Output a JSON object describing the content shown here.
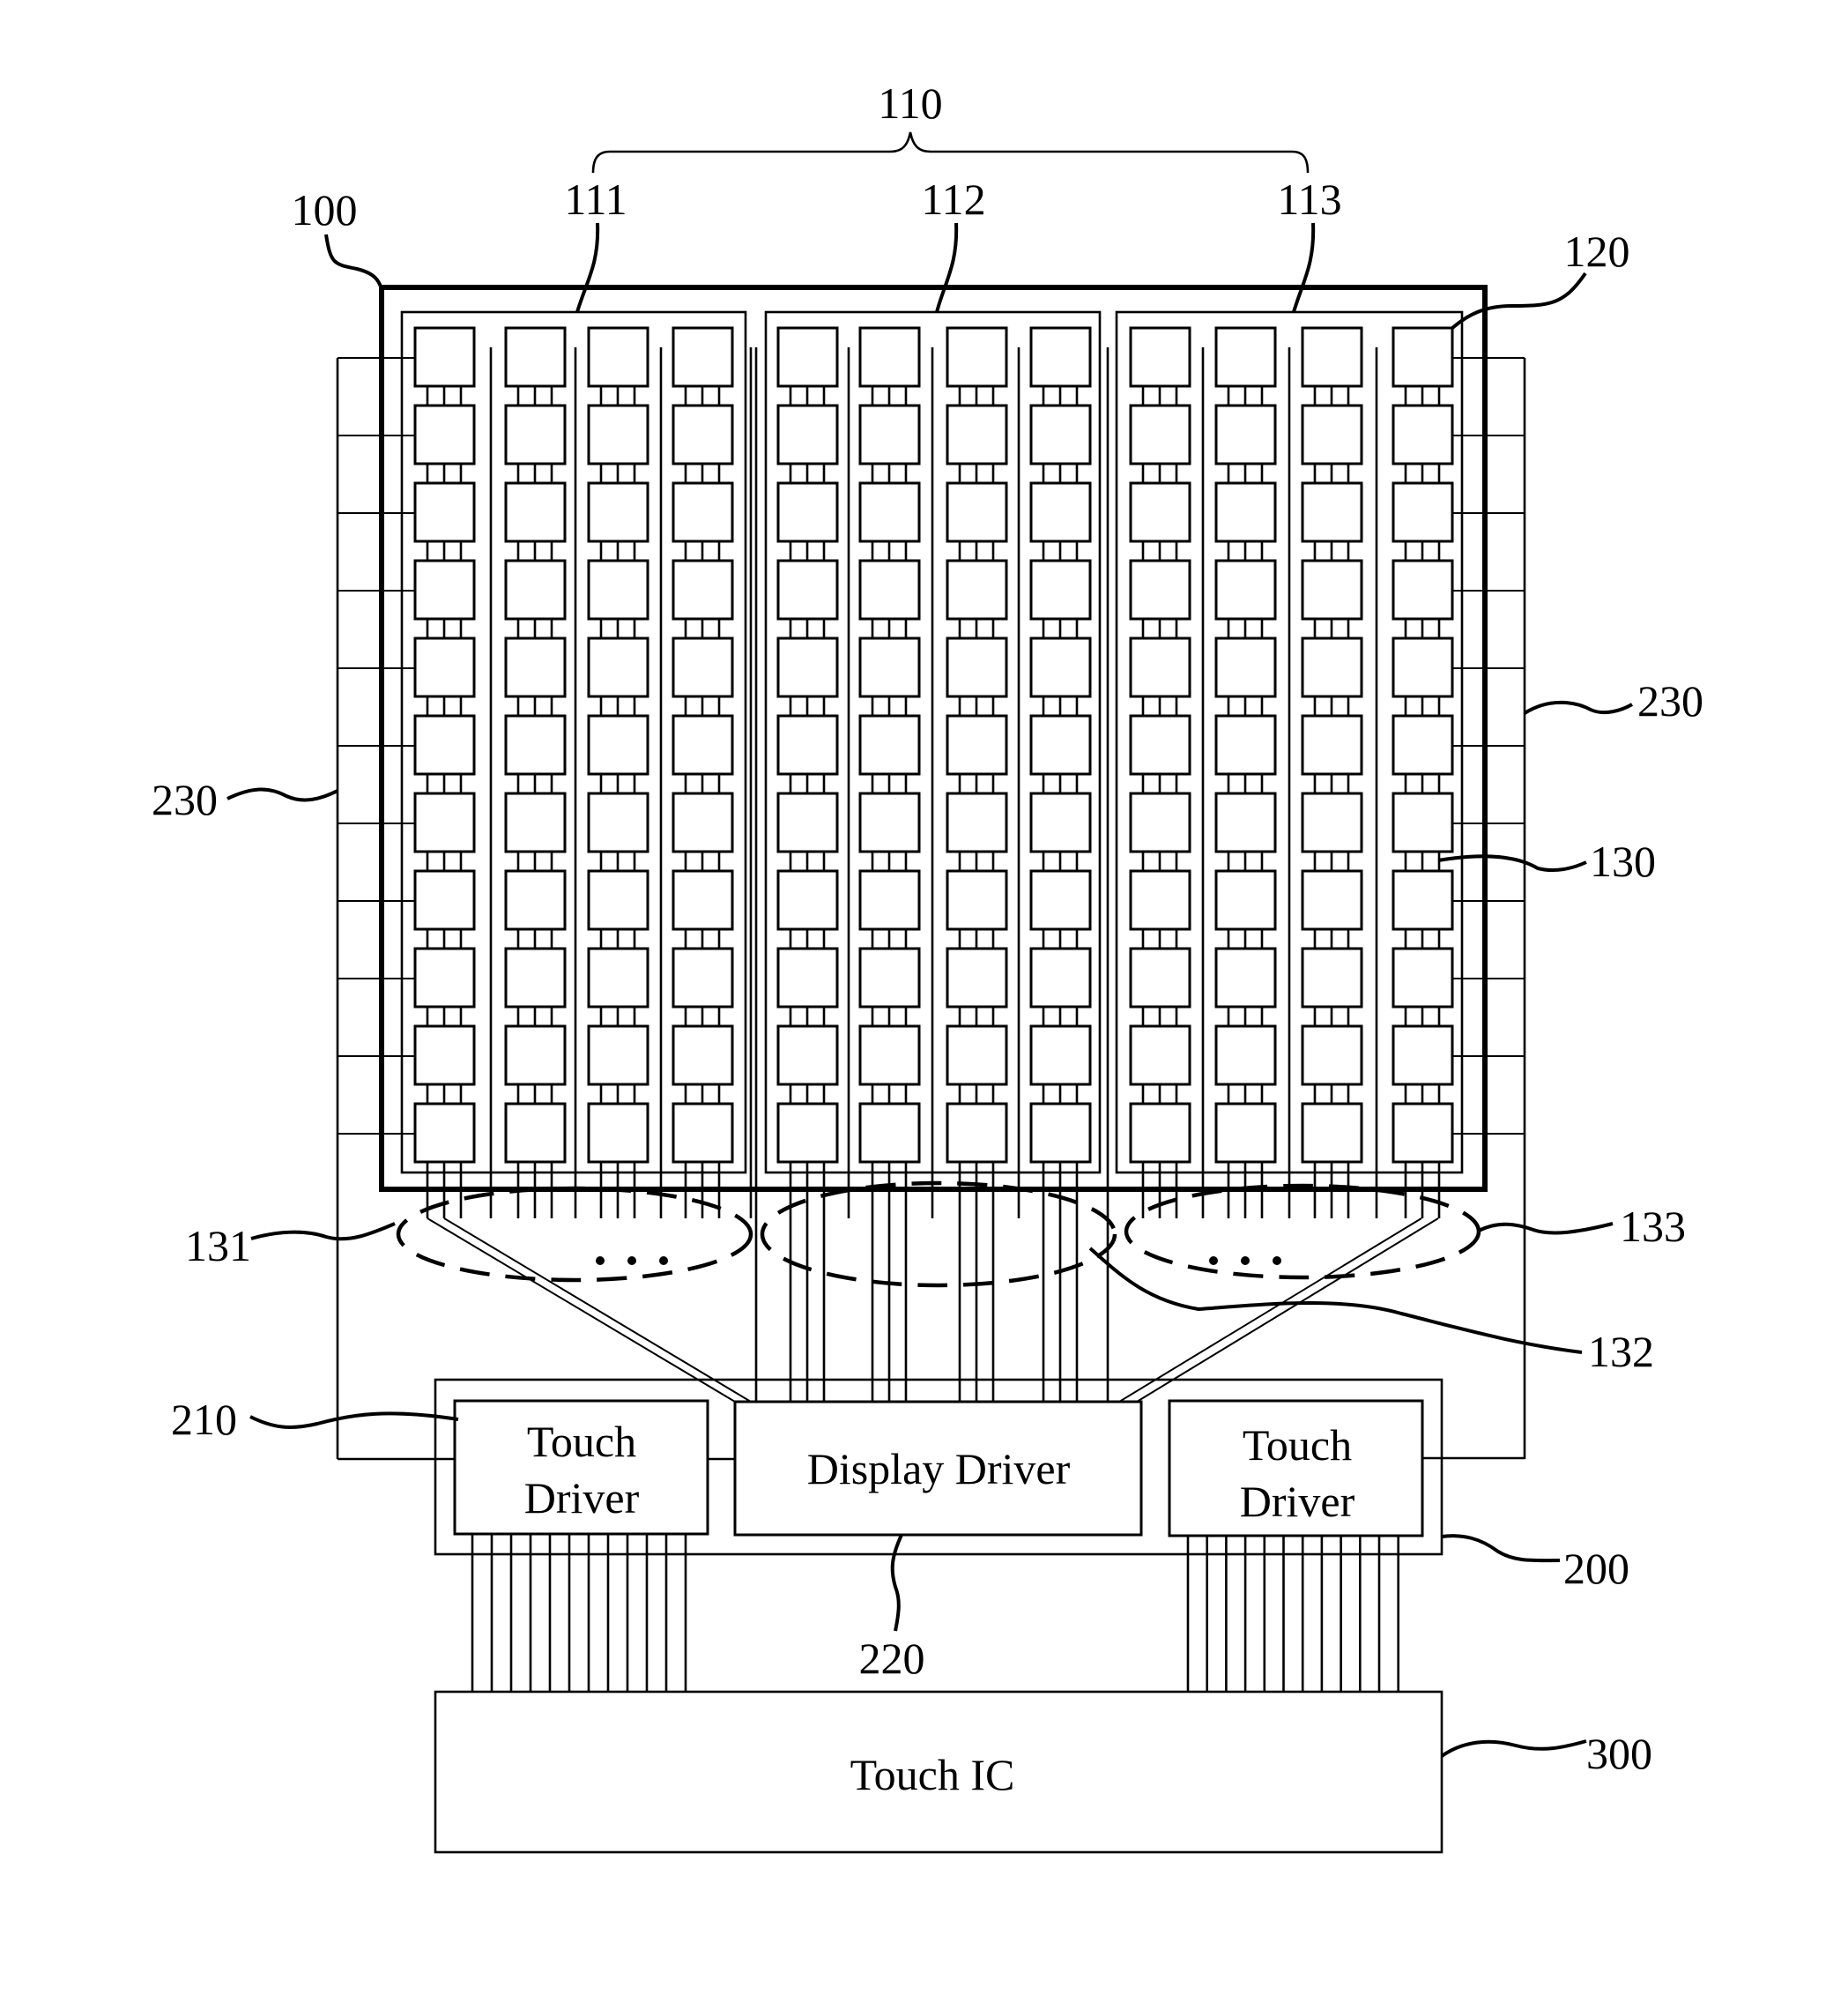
{
  "figure": {
    "type": "patent-block-diagram",
    "description": "Touch display panel with grouped touch electrode columns, display/touch drivers and Touch IC"
  },
  "reference_numerals": {
    "panel": "100",
    "electrode_group_set": "110",
    "group_1": "111",
    "group_2": "112",
    "group_3": "113",
    "electrode_pad": "120",
    "pad_connection_line": "130",
    "line_bundle_1": "131",
    "line_bundle_2": "132",
    "line_bundle_3": "133",
    "driver_board": "200",
    "touch_driver": "210",
    "display_driver": "220",
    "bus_line_left": "230",
    "bus_line_right": "230",
    "touch_ic": "300"
  },
  "blocks": {
    "touch_driver_left": "Touch Driver",
    "touch_driver_left_line1": "Touch",
    "touch_driver_left_line2": "Driver",
    "display_driver": "Display Driver",
    "touch_driver_right_line1": "Touch",
    "touch_driver_right_line2": "Driver",
    "touch_ic": "Touch IC"
  },
  "structure": {
    "electrode_groups": 3,
    "columns_per_group": 4,
    "pad_rows": 11,
    "lines_per_pad_column": 3,
    "touch_driver_output_lines": 12,
    "ellipsis_marker": "• • •"
  }
}
